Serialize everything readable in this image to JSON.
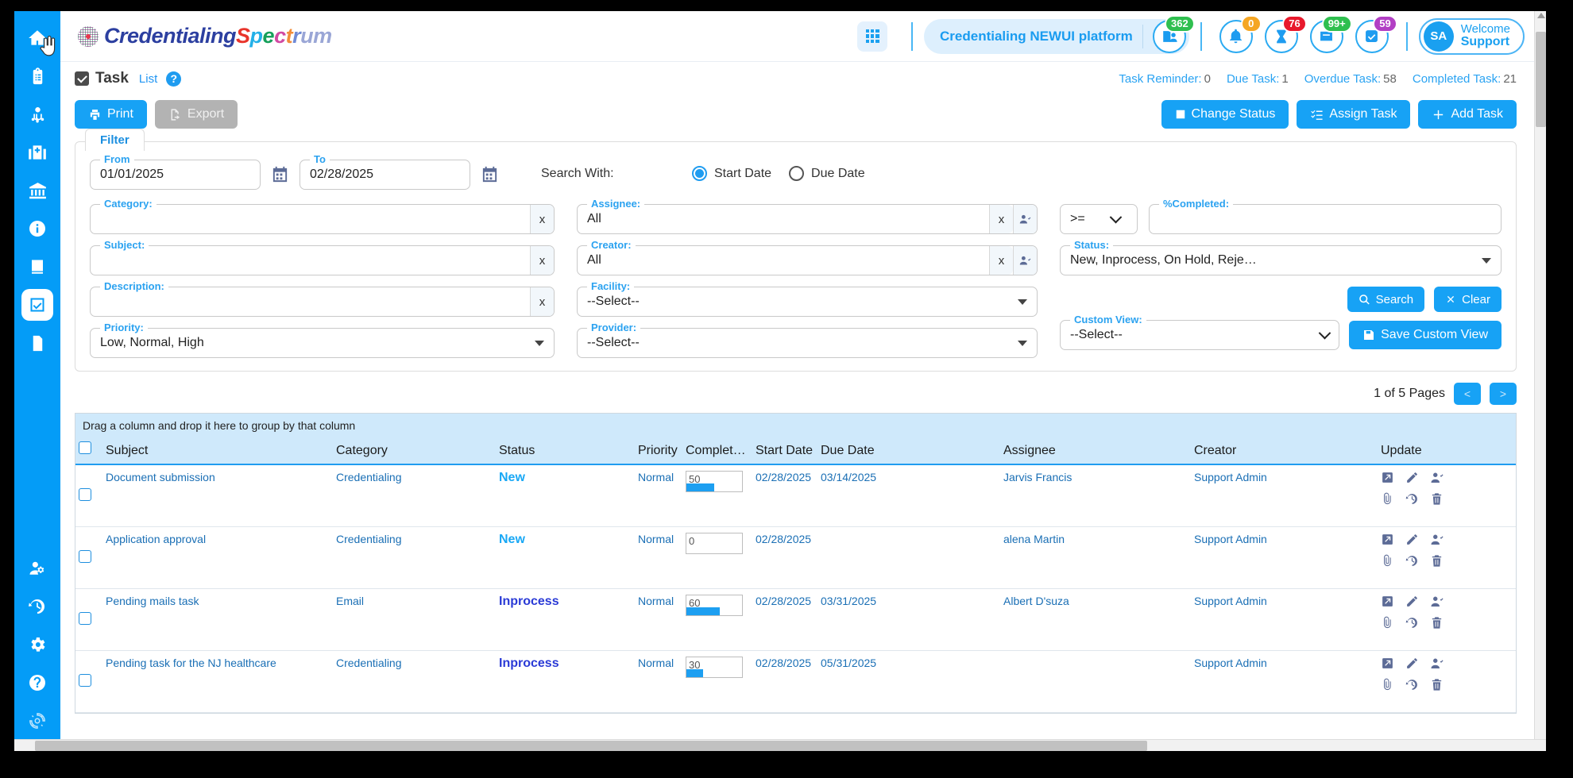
{
  "app": {
    "logo": {
      "brand_part1": "Credentialing",
      "brand_part2": "Spectrum",
      "dot_icon": "logo-dot-icon"
    },
    "apps_grid_icon": "apps-grid-icon",
    "platform": {
      "name": "Credentialing NEWUI platform",
      "provider_icon": "provider-card-icon",
      "provider_badge": "362"
    },
    "notifications": [
      {
        "icon": "bell-icon",
        "badge": "0",
        "color": "#f5a623"
      },
      {
        "icon": "hourglass-icon",
        "badge": "76",
        "color": "#e8192c"
      },
      {
        "icon": "inbox-icon",
        "badge": "99+",
        "color": "#2fbf4f"
      },
      {
        "icon": "checkbox-icon",
        "badge": "59",
        "color": "#b23fc4"
      }
    ],
    "user": {
      "initials": "SA",
      "welcome": "Welcome",
      "name": "Support"
    }
  },
  "sidebar": {
    "top_items": [
      {
        "name": "home",
        "icon": "home-icon"
      },
      {
        "name": "clipboard",
        "icon": "clipboard-list-icon"
      },
      {
        "name": "provider",
        "icon": "doctor-icon"
      },
      {
        "name": "facility",
        "icon": "hospital-icon"
      },
      {
        "name": "payer",
        "icon": "bank-icon"
      },
      {
        "name": "information",
        "icon": "info-circle-icon"
      },
      {
        "name": "library",
        "icon": "book-icon"
      },
      {
        "name": "task",
        "icon": "task-check-icon",
        "active": true
      },
      {
        "name": "reports",
        "icon": "report-document-icon"
      }
    ],
    "bottom_items": [
      {
        "name": "user-settings",
        "icon": "user-cog-icon"
      },
      {
        "name": "activity-history",
        "icon": "history-icon"
      },
      {
        "name": "settings",
        "icon": "gear-icon"
      },
      {
        "name": "help",
        "icon": "question-circle-icon"
      },
      {
        "name": "loading",
        "icon": "spinner-icon"
      }
    ]
  },
  "page": {
    "title": "Task",
    "list_link": "List",
    "help_icon": "help-circle-icon",
    "stats": [
      {
        "label": "Task Reminder:",
        "value": "0"
      },
      {
        "label": "Due Task:",
        "value": "1"
      },
      {
        "label": "Overdue Task:",
        "value": "58"
      },
      {
        "label": "Completed Task:",
        "value": "21"
      }
    ]
  },
  "toolbar": {
    "print": "Print",
    "print_icon": "printer-icon",
    "export": "Export",
    "export_icon": "export-file-icon",
    "change_status": "Change Status",
    "change_status_icon": "square-icon",
    "assign_task": "Assign Task",
    "assign_task_icon": "list-check-icon",
    "add_task": "Add Task",
    "add_task_icon": "plus-icon"
  },
  "filter": {
    "tab_label": "Filter",
    "from": {
      "label": "From",
      "value": "01/01/2025",
      "calendar_icon": "calendar-icon"
    },
    "to": {
      "label": "To",
      "value": "02/28/2025",
      "calendar_icon": "calendar-icon"
    },
    "search_with": {
      "label": "Search With:",
      "options": [
        {
          "label": "Start Date",
          "selected": true
        },
        {
          "label": "Due Date",
          "selected": false
        }
      ]
    },
    "category": {
      "label": "Category:",
      "value": "",
      "clear": "x"
    },
    "subject": {
      "label": "Subject:",
      "value": "",
      "clear": "x"
    },
    "description": {
      "label": "Description:",
      "value": "",
      "clear": "x"
    },
    "priority": {
      "label": "Priority:",
      "value": "Low, Normal, High"
    },
    "assignee": {
      "label": "Assignee:",
      "value": "All",
      "clear": "x",
      "picker_icon": "user-picker-icon"
    },
    "creator": {
      "label": "Creator:",
      "value": "All",
      "clear": "x",
      "picker_icon": "user-picker-icon"
    },
    "facility": {
      "label": "Facility:",
      "value": "--Select--"
    },
    "provider": {
      "label": "Provider:",
      "value": "--Select--"
    },
    "operator": {
      "value": ">="
    },
    "percent_completed": {
      "label": "%Completed:",
      "value": ""
    },
    "status": {
      "label": "Status:",
      "value": "New, Inprocess, On Hold, Reje…"
    },
    "custom_view": {
      "label": "Custom View:",
      "value": "--Select--"
    },
    "search_button": {
      "label": "Search",
      "icon": "search-icon"
    },
    "clear_button": {
      "label": "Clear",
      "icon": "close-x-icon"
    },
    "save_custom_view": {
      "label": "Save Custom View",
      "icon": "save-disk-icon"
    }
  },
  "pagination": {
    "text": "1 of 5 Pages",
    "prev": "<",
    "next": ">"
  },
  "grid": {
    "group_hint": "Drag a column and drop it here to group by that column",
    "columns": [
      "Subject",
      "Category",
      "Status",
      "Priority",
      "Complet…",
      "Start Date",
      "Due Date",
      "Assignee",
      "Creator",
      "Update"
    ],
    "row_action_icons": [
      "external-link-icon",
      "pencil-edit-icon",
      "user-check-icon",
      "paperclip-icon",
      "history-icon",
      "trash-icon"
    ],
    "rows": [
      {
        "subject": "Document submission",
        "category": "Credentialing",
        "status": "New",
        "status_type": "new",
        "priority": "Normal",
        "completed": "50",
        "start_date": "02/28/2025",
        "due_date": "03/14/2025",
        "assignee": "Jarvis Francis",
        "creator": "Support Admin"
      },
      {
        "subject": "Application approval",
        "category": "Credentialing",
        "status": "New",
        "status_type": "new",
        "priority": "Normal",
        "completed": "0",
        "start_date": "02/28/2025",
        "due_date": "",
        "assignee": "alena Martin",
        "creator": "Support Admin"
      },
      {
        "subject": "Pending mails task",
        "category": "Email",
        "status": "Inprocess",
        "status_type": "inprocess",
        "priority": "Normal",
        "completed": "60",
        "start_date": "02/28/2025",
        "due_date": "03/31/2025",
        "assignee": "Albert D'suza",
        "creator": "Support Admin"
      },
      {
        "subject": "Pending task for the NJ healthcare",
        "category": "Credentialing",
        "status": "Inprocess",
        "status_type": "inprocess",
        "priority": "Normal",
        "completed": "30",
        "start_date": "02/28/2025",
        "due_date": "05/31/2025",
        "assignee": "",
        "creator": "Support Admin"
      }
    ]
  },
  "colors": {
    "accent": "#17a2f5",
    "rail": "#049cf7",
    "grid_header": "#cfe9fb",
    "status_new": "#19a8f5",
    "status_inprocess": "#2a3ad6"
  }
}
